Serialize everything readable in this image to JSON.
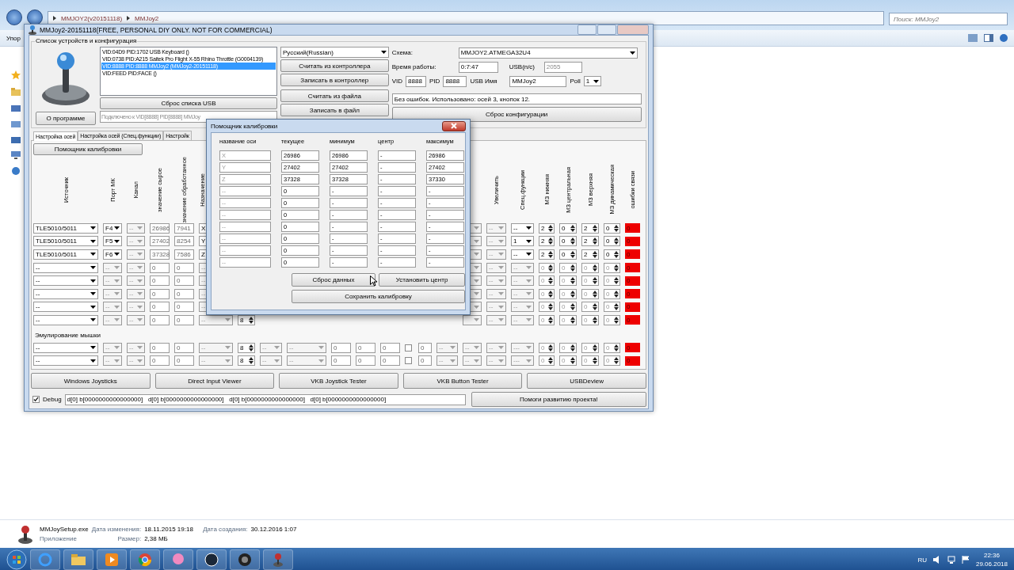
{
  "explorer": {
    "breadcrumb": [
      "MMJOY2(v20151118)",
      "MMJoy2"
    ],
    "search": {
      "placeholder": "Поиск: MMJoy2"
    },
    "toolbar_label": "Упор"
  },
  "app": {
    "title": "MMJoy2-20151118(FREE, PERSONAL DIY ONLY. NOT FOR COMMERCIAL)",
    "devices": {
      "group_title": "Список устройств и конфигурация",
      "about_button": "О программе",
      "list": [
        {
          "label": "VID:04D9 PID:1702 USB Keyboard ()",
          "selected": false
        },
        {
          "label": "VID:0738 PID:A215 Saitek Pro Flight X-55 Rhino Throttle (G0004139)",
          "selected": false
        },
        {
          "label": "VID:8888 PID:8888 MMJoy2 (MMJoy2-20151118)",
          "selected": true
        },
        {
          "label": "VID:FEED PID:FACE  ()",
          "selected": false
        }
      ],
      "reset_usb_button": "Сброс списка USB",
      "connection": "Подключено к VID[8888] PID[8888] MMJoy"
    },
    "language": "Русский(Russian)",
    "actions": [
      "Считать из контроллера",
      "Записать в контроллер",
      "Считать из файла",
      "Записать в файл"
    ],
    "config": {
      "schema_label": "Схема:",
      "schema": "MMJOY2.ATMEGA32U4",
      "uptime_label": "Время работы:",
      "uptime": "0:7:47",
      "usb_sn_label": "USB(п/с)",
      "usb_sn": "2055",
      "vid_label": "VID",
      "vid": "8888",
      "pid_label": "PID",
      "pid": "8888",
      "usb_name_label": "USB Имя",
      "usb_name": "MMJoy2",
      "poll_label": "Poll",
      "poll": "1",
      "status": "Без ошибок. Использовано: осей  3, кнопок  12.",
      "reset_button": "Сброс конфигурации"
    },
    "tabs": [
      {
        "label": "Настройка осей",
        "selected": true
      },
      {
        "label": "Настройка осей (Спец.функции)",
        "selected": false
      },
      {
        "label": "Настройк",
        "selected": false
      }
    ],
    "calibration_button": "Помощник калибровки",
    "axes": {
      "left_headers": [
        "Источник",
        "Порт МК",
        "Канал",
        "значение сырое",
        "значение обработанное",
        "Назначение"
      ],
      "right_headers": [
        "Увеличить",
        "Спец.функции",
        "МЗ нижняя",
        "МЗ центральная",
        "МЗ верхняя",
        "МЗ динамическая",
        "ошибки связи"
      ],
      "rows": [
        {
          "left": [
            {
              "kind": "combo",
              "value": "TLE5010/5011",
              "disabled": false
            },
            {
              "kind": "combo",
              "value": "F4",
              "disabled": false
            },
            {
              "kind": "combo",
              "value": "--",
              "disabled": true
            },
            {
              "kind": "input",
              "value": "26986",
              "disabled": true
            },
            {
              "kind": "input",
              "value": "7941",
              "disabled": true
            },
            {
              "kind": "combo",
              "value": "X",
              "disabled": false
            }
          ],
          "right": [
            {
              "kind": "combo",
              "disabled": true
            },
            {
              "kind": "combo",
              "value": "--",
              "disabled": true
            },
            {
              "kind": "combo",
              "value": "--",
              "disabled": false
            },
            {
              "kind": "spin",
              "value": "2",
              "disabled": false
            },
            {
              "kind": "spin",
              "value": "0",
              "disabled": false
            },
            {
              "kind": "spin",
              "value": "2",
              "disabled": false
            },
            {
              "kind": "spin",
              "value": "0",
              "disabled": false
            },
            {
              "kind": "error",
              "value": "0"
            }
          ]
        },
        {
          "left": [
            {
              "kind": "combo",
              "value": "TLE5010/5011",
              "disabled": false
            },
            {
              "kind": "combo",
              "value": "F5",
              "disabled": false
            },
            {
              "kind": "combo",
              "value": "--",
              "disabled": true
            },
            {
              "kind": "input",
              "value": "27402",
              "disabled": true
            },
            {
              "kind": "input",
              "value": "8254",
              "disabled": true
            },
            {
              "kind": "combo",
              "value": "Y",
              "disabled": false
            }
          ],
          "right": [
            {
              "kind": "combo",
              "disabled": true
            },
            {
              "kind": "combo",
              "value": "--",
              "disabled": true
            },
            {
              "kind": "combo",
              "value": "1",
              "disabled": false
            },
            {
              "kind": "spin",
              "value": "2",
              "disabled": false
            },
            {
              "kind": "spin",
              "value": "0",
              "disabled": false
            },
            {
              "kind": "spin",
              "value": "2",
              "disabled": false
            },
            {
              "kind": "spin",
              "value": "0",
              "disabled": false
            },
            {
              "kind": "error",
              "value": "0"
            }
          ]
        },
        {
          "left": [
            {
              "kind": "combo",
              "value": "TLE5010/5011",
              "disabled": false
            },
            {
              "kind": "combo",
              "value": "F6",
              "disabled": false
            },
            {
              "kind": "combo",
              "value": "--",
              "disabled": true
            },
            {
              "kind": "input",
              "value": "37328",
              "disabled": true
            },
            {
              "kind": "input",
              "value": "7586",
              "disabled": true
            },
            {
              "kind": "combo",
              "value": "Z",
              "disabled": false
            }
          ],
          "right": [
            {
              "kind": "combo",
              "disabled": true
            },
            {
              "kind": "combo",
              "value": "--",
              "disabled": true
            },
            {
              "kind": "combo",
              "value": "--",
              "disabled": false
            },
            {
              "kind": "spin",
              "value": "2",
              "disabled": false
            },
            {
              "kind": "spin",
              "value": "0",
              "disabled": false
            },
            {
              "kind": "spin",
              "value": "2",
              "disabled": false
            },
            {
              "kind": "spin",
              "value": "0",
              "disabled": false
            },
            {
              "kind": "error",
              "value": "0"
            }
          ]
        },
        {
          "left": [
            {
              "kind": "combo",
              "value": "--",
              "disabled": false
            },
            {
              "kind": "combo",
              "value": "--",
              "disabled": true
            },
            {
              "kind": "combo",
              "value": "--",
              "disabled": true
            },
            {
              "kind": "input",
              "value": "0",
              "disabled": true
            },
            {
              "kind": "input",
              "value": "0",
              "disabled": true
            },
            {
              "kind": "combo",
              "value": "--",
              "disabled": true
            }
          ],
          "right": [
            {
              "kind": "combo",
              "disabled": true
            },
            {
              "kind": "combo",
              "value": "--",
              "disabled": true
            },
            {
              "kind": "combo",
              "value": "--",
              "disabled": true
            },
            {
              "kind": "spin",
              "value": "0",
              "disabled": true
            },
            {
              "kind": "spin",
              "value": "0",
              "disabled": true
            },
            {
              "kind": "spin",
              "value": "0",
              "disabled": true
            },
            {
              "kind": "spin",
              "value": "0",
              "disabled": true
            },
            {
              "kind": "error",
              "value": "0"
            }
          ]
        },
        {
          "left": [
            {
              "kind": "combo",
              "value": "--",
              "disabled": false
            },
            {
              "kind": "combo",
              "value": "--",
              "disabled": true
            },
            {
              "kind": "combo",
              "value": "--",
              "disabled": true
            },
            {
              "kind": "input",
              "value": "0",
              "disabled": true
            },
            {
              "kind": "input",
              "value": "0",
              "disabled": true
            },
            {
              "kind": "combo",
              "value": "--",
              "disabled": true
            }
          ],
          "right": [
            {
              "kind": "combo",
              "disabled": true
            },
            {
              "kind": "combo",
              "value": "--",
              "disabled": true
            },
            {
              "kind": "combo",
              "value": "--",
              "disabled": true
            },
            {
              "kind": "spin",
              "value": "0",
              "disabled": true
            },
            {
              "kind": "spin",
              "value": "0",
              "disabled": true
            },
            {
              "kind": "spin",
              "value": "0",
              "disabled": true
            },
            {
              "kind": "spin",
              "value": "0",
              "disabled": true
            },
            {
              "kind": "error",
              "value": "0"
            }
          ]
        },
        {
          "left": [
            {
              "kind": "combo",
              "value": "--",
              "disabled": false
            },
            {
              "kind": "combo",
              "value": "--",
              "disabled": true
            },
            {
              "kind": "combo",
              "value": "--",
              "disabled": true
            },
            {
              "kind": "input",
              "value": "0",
              "disabled": true
            },
            {
              "kind": "input",
              "value": "0",
              "disabled": true
            },
            {
              "kind": "combo",
              "value": "--",
              "disabled": true
            }
          ],
          "right": [
            {
              "kind": "combo",
              "disabled": true
            },
            {
              "kind": "combo",
              "value": "--",
              "disabled": true
            },
            {
              "kind": "combo",
              "value": "--",
              "disabled": true
            },
            {
              "kind": "spin",
              "value": "0",
              "disabled": true
            },
            {
              "kind": "spin",
              "value": "0",
              "disabled": true
            },
            {
              "kind": "spin",
              "value": "0",
              "disabled": true
            },
            {
              "kind": "spin",
              "value": "0",
              "disabled": true
            },
            {
              "kind": "error",
              "value": "0"
            }
          ]
        },
        {
          "left": [
            {
              "kind": "combo",
              "value": "--",
              "disabled": false
            },
            {
              "kind": "combo",
              "value": "--",
              "disabled": true
            },
            {
              "kind": "combo",
              "value": "--",
              "disabled": true
            },
            {
              "kind": "input",
              "value": "0",
              "disabled": true
            },
            {
              "kind": "input",
              "value": "0",
              "disabled": true
            },
            {
              "kind": "combo",
              "value": "--",
              "disabled": true
            }
          ],
          "right": [
            {
              "kind": "combo",
              "disabled": true
            },
            {
              "kind": "combo",
              "value": "--",
              "disabled": true
            },
            {
              "kind": "combo",
              "value": "--",
              "disabled": true
            },
            {
              "kind": "spin",
              "value": "0",
              "disabled": true
            },
            {
              "kind": "spin",
              "value": "0",
              "disabled": true
            },
            {
              "kind": "spin",
              "value": "0",
              "disabled": true
            },
            {
              "kind": "spin",
              "value": "0",
              "disabled": true
            },
            {
              "kind": "error",
              "value": "0"
            }
          ]
        },
        {
          "left": [
            {
              "kind": "combo",
              "value": "--",
              "disabled": false
            },
            {
              "kind": "combo",
              "value": "--",
              "disabled": true
            },
            {
              "kind": "combo",
              "value": "--",
              "disabled": true
            },
            {
              "kind": "input",
              "value": "0",
              "disabled": true
            },
            {
              "kind": "input",
              "value": "0",
              "disabled": true
            },
            {
              "kind": "combo",
              "value": "--",
              "disabled": true
            }
          ],
          "middle": [
            {
              "kind": "spin",
              "value": "8",
              "disabled": false
            }
          ],
          "right": [
            {
              "kind": "combo",
              "disabled": true
            },
            {
              "kind": "combo",
              "value": "--",
              "disabled": true
            },
            {
              "kind": "combo",
              "value": "--",
              "disabled": true
            },
            {
              "kind": "spin",
              "value": "0",
              "disabled": true
            },
            {
              "kind": "spin",
              "value": "0",
              "disabled": true
            },
            {
              "kind": "spin",
              "value": "0",
              "disabled": true
            },
            {
              "kind": "spin",
              "value": "0",
              "disabled": true
            },
            {
              "kind": "error",
              "value": "0"
            }
          ]
        }
      ],
      "mouse_label": "Эмулирование мышки",
      "mouse_rows": [
        {
          "left": [
            {
              "kind": "combo",
              "value": "--",
              "disabled": false
            },
            {
              "kind": "combo",
              "value": "--",
              "disabled": true
            },
            {
              "kind": "combo",
              "value": "--",
              "disabled": true
            },
            {
              "kind": "input",
              "value": "0",
              "disabled": true
            },
            {
              "kind": "input",
              "value": "0",
              "disabled": true
            },
            {
              "kind": "combo",
              "value": "--",
              "disabled": true
            }
          ],
          "middle": [
            {
              "kind": "spin",
              "value": "8",
              "disabled": false
            },
            {
              "kind": "combo",
              "value": "--",
              "disabled": true
            },
            {
              "kind": "combo",
              "value": "--",
              "disabled": true
            },
            {
              "kind": "input",
              "value": "0",
              "disabled": true
            },
            {
              "kind": "input",
              "value": "0",
              "disabled": true
            },
            {
              "kind": "input",
              "value": "0",
              "disabled": true
            },
            {
              "kind": "check",
              "checked": false
            },
            {
              "kind": "input",
              "value": "0",
              "disabled": true
            },
            {
              "kind": "combo",
              "value": "--",
              "disabled": true
            }
          ],
          "right": [
            {
              "kind": "combo",
              "value": "--",
              "disabled": true
            },
            {
              "kind": "combo",
              "value": "--",
              "disabled": true
            },
            {
              "kind": "combo",
              "value": "---",
              "disabled": true
            },
            {
              "kind": "spin",
              "value": "0",
              "disabled": true
            },
            {
              "kind": "spin",
              "value": "0",
              "disabled": true
            },
            {
              "kind": "spin",
              "value": "0",
              "disabled": true
            },
            {
              "kind": "spin",
              "value": "0",
              "disabled": true
            },
            {
              "kind": "error",
              "value": "0"
            }
          ]
        },
        {
          "left": [
            {
              "kind": "combo",
              "value": "--",
              "disabled": false
            },
            {
              "kind": "combo",
              "value": "--",
              "disabled": true
            },
            {
              "kind": "combo",
              "value": "--",
              "disabled": true
            },
            {
              "kind": "input",
              "value": "0",
              "disabled": true
            },
            {
              "kind": "input",
              "value": "0",
              "disabled": true
            },
            {
              "kind": "combo",
              "value": "--",
              "disabled": true
            }
          ],
          "middle": [
            {
              "kind": "spin",
              "value": "8",
              "disabled": false
            },
            {
              "kind": "combo",
              "value": "--",
              "disabled": true
            },
            {
              "kind": "combo",
              "value": "--",
              "disabled": true
            },
            {
              "kind": "input",
              "value": "0",
              "disabled": true
            },
            {
              "kind": "input",
              "value": "0",
              "disabled": true
            },
            {
              "kind": "input",
              "value": "0",
              "disabled": true
            },
            {
              "kind": "check",
              "checked": false
            },
            {
              "kind": "input",
              "value": "0",
              "disabled": true
            },
            {
              "kind": "combo",
              "value": "--",
              "disabled": true
            }
          ],
          "right": [
            {
              "kind": "combo",
              "value": "--",
              "disabled": true
            },
            {
              "kind": "combo",
              "value": "--",
              "disabled": true
            },
            {
              "kind": "combo",
              "value": "---",
              "disabled": true
            },
            {
              "kind": "spin",
              "value": "0",
              "disabled": true
            },
            {
              "kind": "spin",
              "value": "0",
              "disabled": true
            },
            {
              "kind": "spin",
              "value": "0",
              "disabled": true
            },
            {
              "kind": "spin",
              "value": "0",
              "disabled": true
            },
            {
              "kind": "error",
              "value": "0"
            }
          ]
        }
      ]
    },
    "tools": [
      "Windows Joysticks",
      "Direct Input Viewer",
      "VKB Joystick Tester",
      "VKB Button Tester",
      "USBDeview"
    ],
    "debug": {
      "label": "Debug",
      "checked": true,
      "value": "d[0] b[0000000000000000]   d[0] b[0000000000000000]   d[0] b[0000000000000000]   d[0] b[0000000000000000]"
    },
    "support_button": "Помоги развитию проекта!"
  },
  "calibration_dialog": {
    "title": "Помощник калибровки",
    "columns": [
      "название оси",
      "текущее",
      "минимум",
      "центр",
      "максимум"
    ],
    "rows": [
      {
        "name": "X",
        "current": "26986",
        "min": "26986",
        "center": "-",
        "max": "26986"
      },
      {
        "name": "Y",
        "current": "27402",
        "min": "27402",
        "center": "-",
        "max": "27402"
      },
      {
        "name": "Z",
        "current": "37328",
        "min": "37328",
        "center": "-",
        "max": "37330"
      },
      {
        "name": "--",
        "current": "0",
        "min": "-",
        "center": "-",
        "max": "-"
      },
      {
        "name": "--",
        "current": "0",
        "min": "-",
        "center": "-",
        "max": "-"
      },
      {
        "name": "--",
        "current": "0",
        "min": "-",
        "center": "-",
        "max": "-"
      },
      {
        "name": "--",
        "current": "0",
        "min": "-",
        "center": "-",
        "max": "-"
      },
      {
        "name": "--",
        "current": "0",
        "min": "-",
        "center": "-",
        "max": "-"
      },
      {
        "name": "--",
        "current": "0",
        "min": "-",
        "center": "-",
        "max": "-"
      },
      {
        "name": "--",
        "current": "0",
        "min": "-",
        "center": "-",
        "max": "-"
      }
    ],
    "reset_button": "Сброс данных",
    "center_button": "Установить центр",
    "save_button": "Сохранить калибровку"
  },
  "details": {
    "file_name": "MMJoySetup.exe",
    "type": "Приложение",
    "modified_label": "Дата изменения:",
    "modified": "18.11.2015 19:18",
    "size_label": "Размер:",
    "size": "2,38 МБ",
    "created_label": "Дата создания:",
    "created": "30.12.2016 1:07"
  },
  "taskbar": {
    "language": "RU",
    "time": "22:36",
    "date": "29.06.2018"
  }
}
